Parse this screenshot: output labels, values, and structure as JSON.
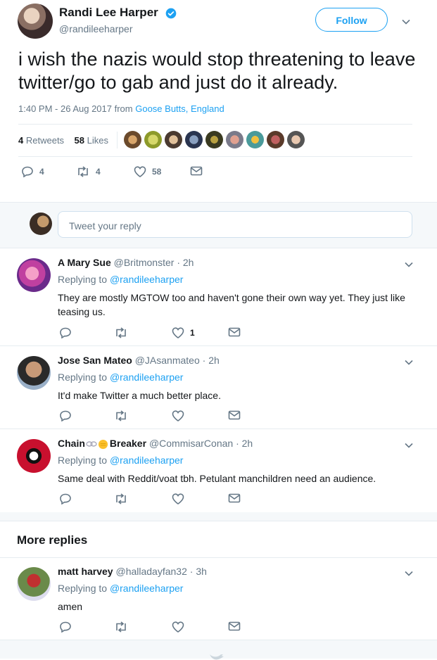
{
  "tweet": {
    "author_name": "Randi Lee Harper",
    "author_handle": "@randileeharper",
    "follow_label": "Follow",
    "text": "i wish the nazis would stop threatening to leave twitter/go to gab and just do it already.",
    "timestamp": "1:40 PM - 26 Aug 2017",
    "from_label": "from",
    "location": "Goose Butts, England",
    "retweets_count": "4",
    "retweets_label": "Retweets",
    "likes_count": "58",
    "likes_label": "Likes",
    "reply_count": "4",
    "retweet_count_action": "4",
    "like_count_action": "58"
  },
  "compose": {
    "placeholder": "Tweet your reply"
  },
  "replies": [
    {
      "name": "A Mary Sue",
      "handle": "@Britmonster",
      "time": "2h",
      "replying_to_label": "Replying to",
      "replying_to": "@randileeharper",
      "text": "They are mostly MGTOW too and haven't gone their own way yet. They just like teasing us.",
      "likes": "1"
    },
    {
      "name": "Jose San Mateo",
      "handle": "@JAsanmateo",
      "time": "2h",
      "replying_to_label": "Replying to",
      "replying_to": "@randileeharper",
      "text": "It'd make Twitter a much better place.",
      "likes": ""
    },
    {
      "name_part1": "Chain",
      "name_part2": "Breaker",
      "handle": "@CommisarConan",
      "time": "2h",
      "replying_to_label": "Replying to",
      "replying_to": "@randileeharper",
      "text": "Same deal with Reddit/voat tbh. Petulant manchildren need an audience.",
      "likes": ""
    }
  ],
  "more_replies": {
    "title": "More replies",
    "items": [
      {
        "name": "matt harvey",
        "handle": "@halladayfan32",
        "time": "3h",
        "replying_to_label": "Replying to",
        "replying_to": "@randileeharper",
        "text": "amen"
      }
    ]
  },
  "colors": {
    "accent": "#1da1f2",
    "text": "#14171a",
    "muted": "#657786",
    "verified": "#1da1f2"
  },
  "icons": [
    "reply-icon",
    "retweet-icon",
    "heart-icon",
    "dm-icon",
    "chevron-down-icon",
    "verified-icon",
    "twitter-bird-icon"
  ]
}
